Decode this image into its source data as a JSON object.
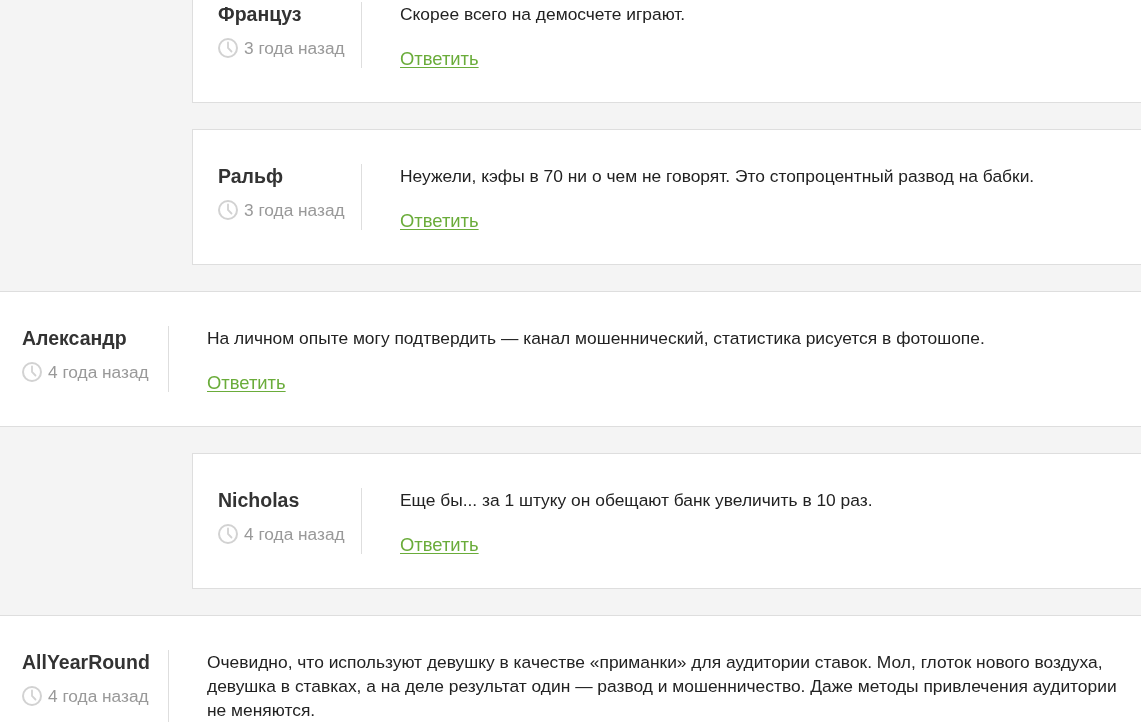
{
  "replies_above": [
    {
      "author": "Француз",
      "time": "3 года назад",
      "text": "Скорее всего на демосчете играют.",
      "reply_link": "Ответить"
    },
    {
      "author": "Ральф",
      "time": "3 года назад",
      "text": "Неужели, кэфы в 70 ни о чем не говорят. Это стопроцентный развод на бабки.",
      "reply_link": "Ответить"
    }
  ],
  "comments": [
    {
      "author": "Александр",
      "time": "4 года назад",
      "text": "На личном опыте могу подтвердить — канал мошеннический, статистика рисуется в фотошопе.",
      "reply_link": "Ответить",
      "replies": [
        {
          "author": "Nicholas",
          "time": "4 года назад",
          "text": "Еще бы... за 1 штуку он обещают банк увеличить в 10 раз.",
          "reply_link": "Ответить"
        }
      ]
    },
    {
      "author": "AllYearRound",
      "time": "4 года назад",
      "text": "Очевидно, что используют девушку в качестве «приманки» для аудитории ставок. Мол, глоток нового воздуха, девушка в ставках, а на деле результат один — развод и мошенничество. Даже методы привлечения аудитории не меняются."
    }
  ]
}
